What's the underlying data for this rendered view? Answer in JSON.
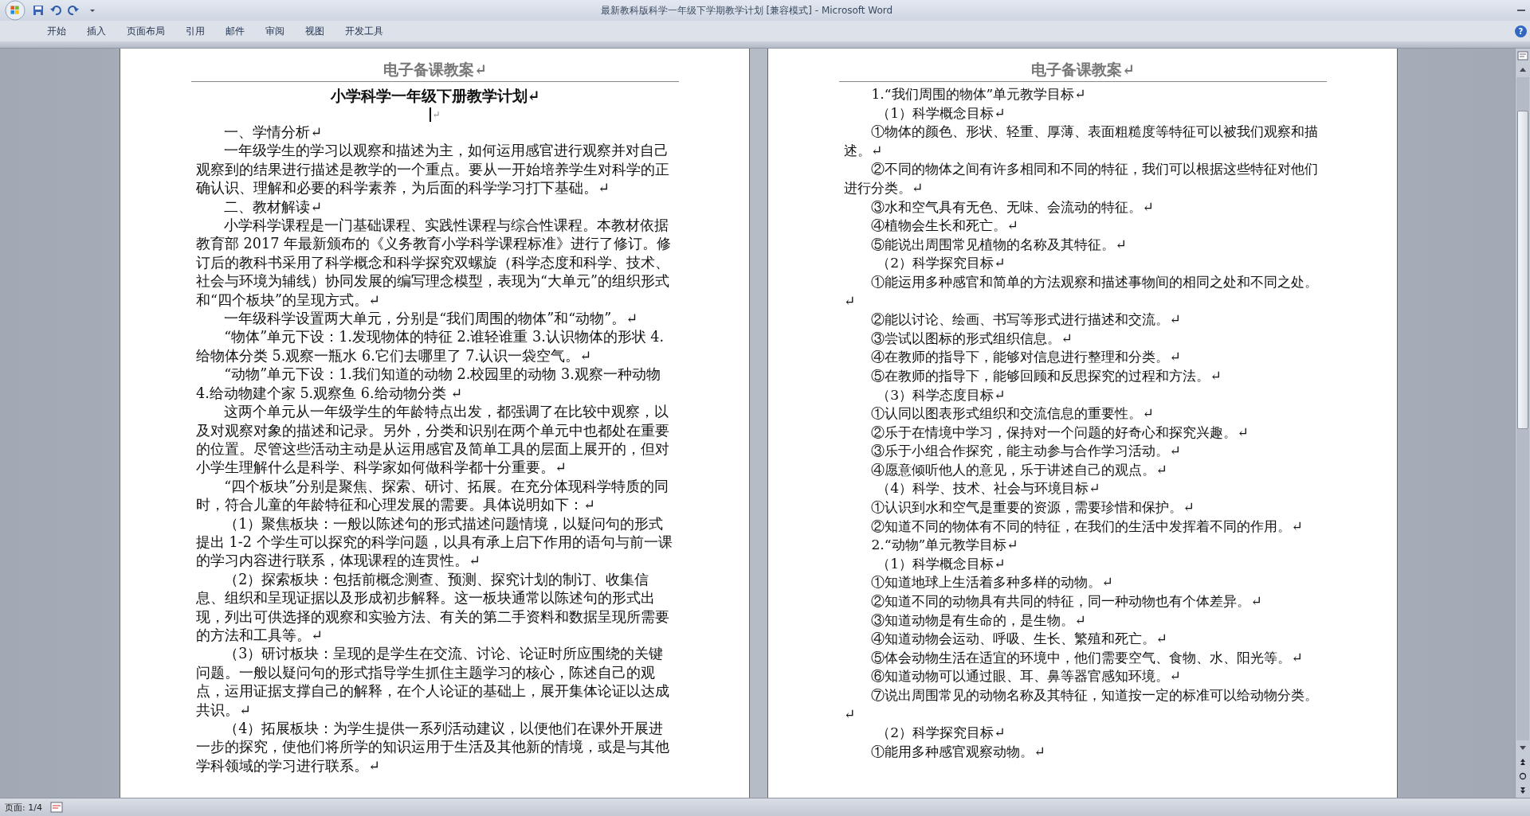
{
  "window": {
    "title": "最新教科版科学一年级下学期教学计划 [兼容模式] - Microsoft Word"
  },
  "ribbon_tabs": [
    "开始",
    "插入",
    "页面布局",
    "引用",
    "邮件",
    "审阅",
    "视图",
    "开发工具"
  ],
  "help": "?",
  "left_page": {
    "header": "电子备课教案↵",
    "title": "小学科学一年级下册教学计划↵",
    "cursor_mark": "↵",
    "paragraphs": [
      "一、学情分析↵",
      "一年级学生的学习以观察和描述为主，如何运用感官进行观察并对自己观察到的结果进行描述是教学的一个重点。要从一开始培养学生对科学的正确认识、理解和必要的科学素养，为后面的科学学习打下基础。↵",
      "二、教材解读↵",
      "小学科学课程是一门基础课程、实践性课程与综合性课程。本教材依据教育部 2017 年最新颁布的《义务教育小学科学课程标准》进行了修订。修订后的教科书采用了科学概念和科学探究双螺旋（科学态度和科学、技术、社会与环境为辅线）协同发展的编写理念模型，表现为“大单元”的组织形式和“四个板块”的呈现方式。↵",
      "一年级科学设置两大单元，分别是“我们周围的物体”和“动物”。↵",
      "“物体”单元下设：1.发现物体的特征 2.谁轻谁重 3.认识物体的形状 4.给物体分类 5.观察一瓶水 6.它们去哪里了 7.认识一袋空气。↵",
      "“动物”单元下设：1.我们知道的动物 2.校园里的动物 3.观察一种动物 4.给动物建个家 5.观察鱼 6.给动物分类 ↵",
      "这两个单元从一年级学生的年龄特点出发，都强调了在比较中观察，以及对观察对象的描述和记录。另外，分类和识别在两个单元中也都处在重要的位置。尽管这些活动主动是从运用感官及简单工具的层面上展开的，但对小学生理解什么是科学、科学家如何做科学都十分重要。↵",
      "“四个板块”分别是聚焦、探索、研讨、拓展。在充分体现科学特质的同时，符合儿童的年龄特征和心理发展的需要。具体说明如下：↵",
      "（1）聚焦板块：一般以陈述句的形式描述问题情境，以疑问句的形式提出 1-2 个学生可以探究的科学问题，以具有承上启下作用的语句与前一课的学习内容进行联系，体现课程的连贯性。↵",
      "（2）探索板块：包括前概念测查、预测、探究计划的制订、收集信息、组织和呈现证据以及形成初步解释。这一板块通常以陈述句的形式出现，列出可供选择的观察和实验方法、有关的第二手资料和数据呈现所需要的方法和工具等。↵",
      "（3）研讨板块：呈现的是学生在交流、讨论、论证时所应围绕的关键问题。一般以疑问句的形式指导学生抓住主题学习的核心，陈述自己的观点，运用证据支撑自己的解释，在个人论证的基础上，展开集体论证以达成共识。↵",
      "（4）拓展板块：为学生提供一系列活动建议，以便他们在课外开展进一步的探究，使他们将所学的知识运用于生活及其他新的情境，或是与其他学科领域的学习进行联系。↵"
    ]
  },
  "right_page": {
    "header": "电子备课教案↵",
    "lines": [
      {
        "kind": "heading",
        "text": "1.“我们周围的物体”单元教学目标↵"
      },
      {
        "kind": "sub",
        "text": "（1）科学概念目标↵"
      },
      {
        "kind": "item",
        "text": "①物体的颜色、形状、轻重、厚薄、表面粗糙度等特征可以被我们观察和描述。↵"
      },
      {
        "kind": "item",
        "text": "②不同的物体之间有许多相同和不同的特征，我们可以根据这些特征对他们进行分类。↵"
      },
      {
        "kind": "item",
        "text": "③水和空气具有无色、无味、会流动的特征。↵"
      },
      {
        "kind": "item",
        "text": "④植物会生长和死亡。↵"
      },
      {
        "kind": "item",
        "text": "⑤能说出周围常见植物的名称及其特征。↵"
      },
      {
        "kind": "sub",
        "text": "（2）科学探究目标↵"
      },
      {
        "kind": "item",
        "text": "①能运用多种感官和简单的方法观察和描述事物间的相同之处和不同之处。↵"
      },
      {
        "kind": "item",
        "text": "②能以讨论、绘画、书写等形式进行描述和交流。↵"
      },
      {
        "kind": "item",
        "text": "③尝试以图标的形式组织信息。↵"
      },
      {
        "kind": "item",
        "text": "④在教师的指导下，能够对信息进行整理和分类。↵"
      },
      {
        "kind": "item",
        "text": "⑤在教师的指导下，能够回顾和反思探究的过程和方法。↵"
      },
      {
        "kind": "sub",
        "text": "（3）科学态度目标↵"
      },
      {
        "kind": "item",
        "text": "①认同以图表形式组织和交流信息的重要性。↵"
      },
      {
        "kind": "item",
        "text": "②乐于在情境中学习，保持对一个问题的好奇心和探究兴趣。↵"
      },
      {
        "kind": "item",
        "text": "③乐于小组合作探究，能主动参与合作学习活动。↵"
      },
      {
        "kind": "item",
        "text": "④愿意倾听他人的意见，乐于讲述自己的观点。↵"
      },
      {
        "kind": "sub",
        "text": "（4）科学、技术、社会与环境目标↵"
      },
      {
        "kind": "item",
        "text": "①认识到水和空气是重要的资源，需要珍惜和保护。↵"
      },
      {
        "kind": "item",
        "text": "②知道不同的物体有不同的特征，在我们的生活中发挥着不同的作用。↵"
      },
      {
        "kind": "heading",
        "text": "2.“动物”单元教学目标↵"
      },
      {
        "kind": "sub",
        "text": "（1）科学概念目标↵"
      },
      {
        "kind": "item",
        "text": "①知道地球上生活着多种多样的动物。↵"
      },
      {
        "kind": "item",
        "text": "②知道不同的动物具有共同的特征，同一种动物也有个体差异。↵"
      },
      {
        "kind": "item",
        "text": "③知道动物是有生命的，是生物。↵"
      },
      {
        "kind": "item",
        "text": "④知道动物会运动、呼吸、生长、繁殖和死亡。↵"
      },
      {
        "kind": "item",
        "text": "⑤体会动物生活在适宜的环境中，他们需要空气、食物、水、阳光等。↵"
      },
      {
        "kind": "item",
        "text": "⑥知道动物可以通过眼、耳、鼻等器官感知环境。↵"
      },
      {
        "kind": "item",
        "text": "⑦说出周围常见的动物名称及其特征，知道按一定的标准可以给动物分类。↵"
      },
      {
        "kind": "sub",
        "text": "（2）科学探究目标↵"
      },
      {
        "kind": "item",
        "text": "①能用多种感官观察动物。↵"
      }
    ]
  },
  "status_bar": {
    "page": "页面: 1/4"
  }
}
